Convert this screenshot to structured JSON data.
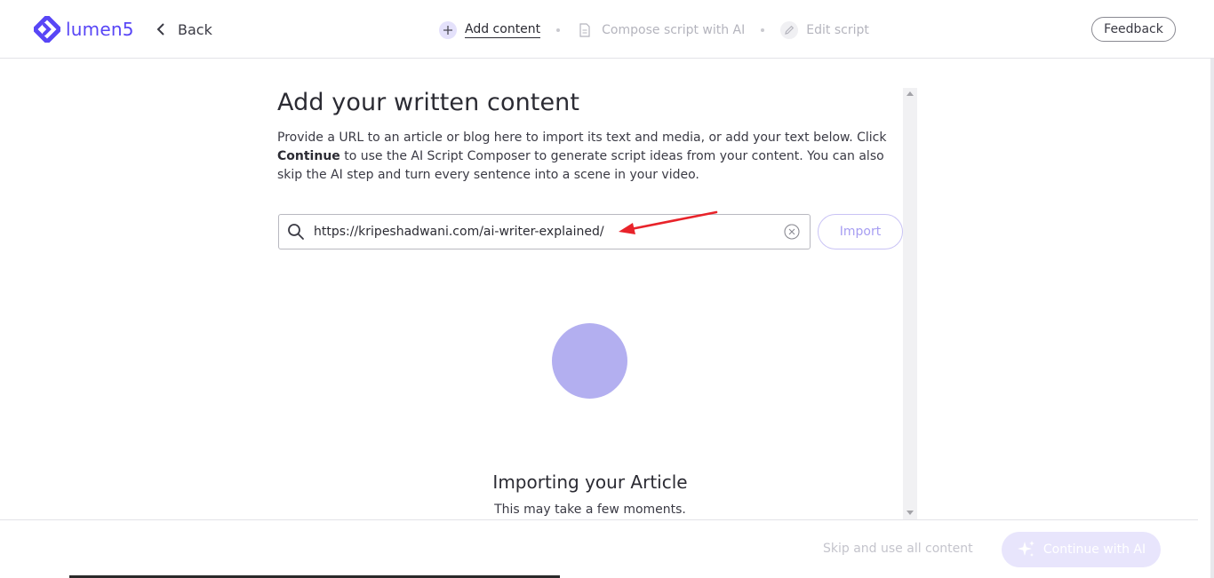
{
  "header": {
    "logo_text": "lumen5",
    "back_label": "Back",
    "steps": [
      {
        "label": "Add content",
        "state": "active"
      },
      {
        "label": "Compose script with AI",
        "state": "inactive"
      },
      {
        "label": "Edit script",
        "state": "inactive"
      }
    ],
    "feedback_label": "Feedback"
  },
  "main": {
    "title": "Add your written content",
    "description_part1": "Provide a URL to an article or blog here to import its text and media, or add your text below. Click ",
    "description_bold": "Continue",
    "description_part2": " to use the AI Script Composer to generate script ideas from your content. You can also skip the AI step and turn every sentence into a scene in your video.",
    "url_value": "https://kripeshadwani.com/ai-writer-explained/",
    "import_label": "Import",
    "importing_title": "Importing your Article",
    "importing_subtitle": "This may take a few moments."
  },
  "footer": {
    "skip_label": "Skip and use all content",
    "continue_label": "Continue with AI"
  },
  "colors": {
    "brand": "#5846f6",
    "loader": "#b3aff0",
    "annotation_arrow": "#e8232a"
  }
}
